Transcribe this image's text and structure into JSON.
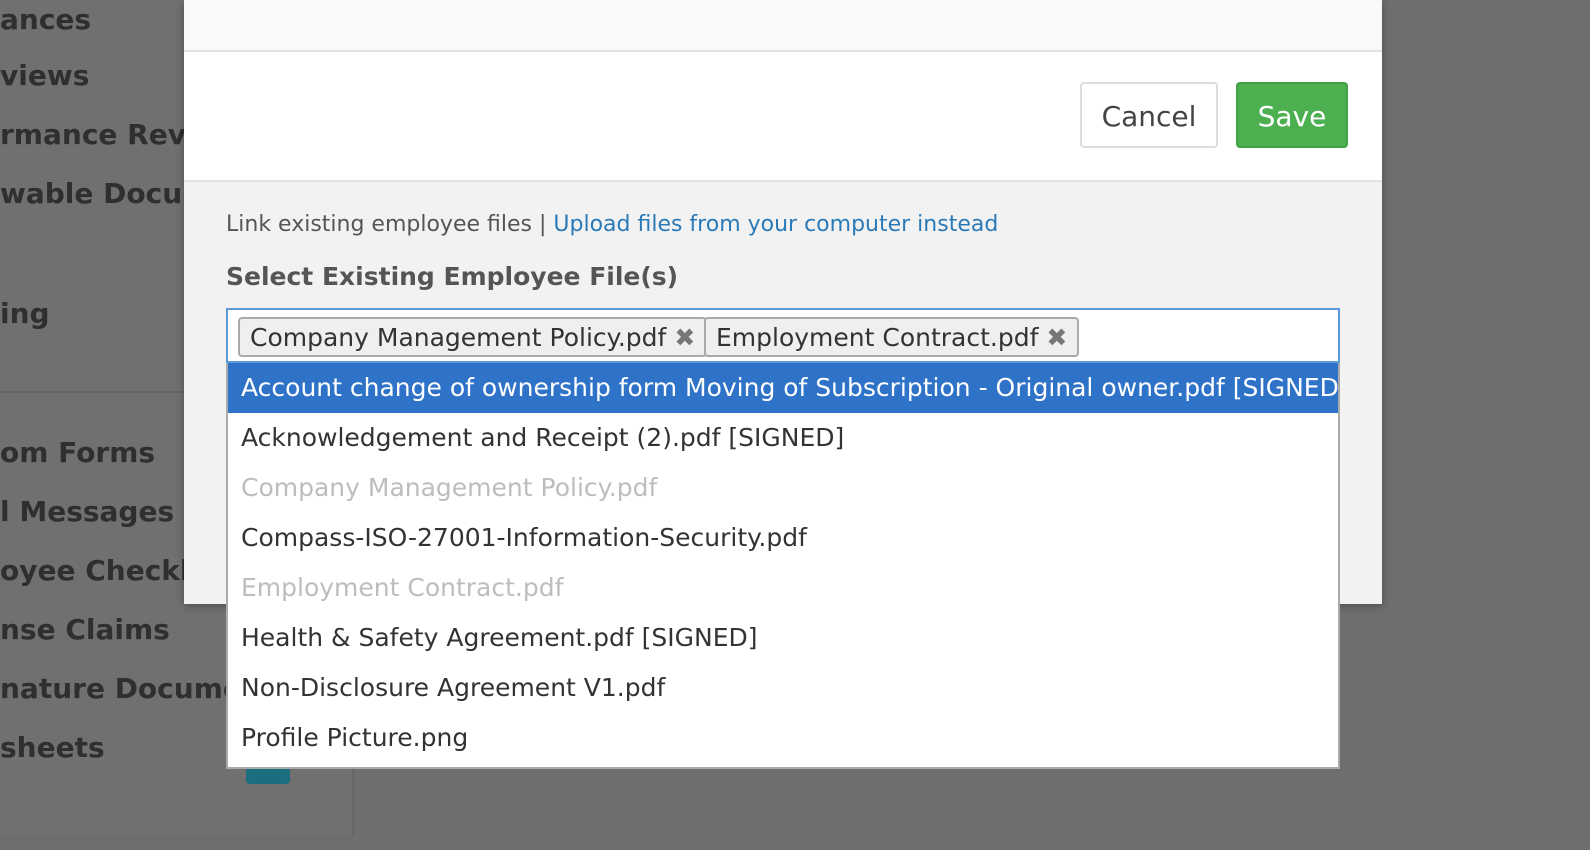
{
  "sidebar": {
    "items": [
      {
        "label": "ances"
      },
      {
        "label": "views"
      },
      {
        "label": "rmance Revie"
      },
      {
        "label": "wable Docume"
      },
      {
        "label": "ing"
      },
      {
        "label": "om Forms"
      },
      {
        "label": "l Messages"
      },
      {
        "label": "oyee Checklist"
      },
      {
        "label": "nse Claims"
      },
      {
        "label": "nature Documents"
      },
      {
        "label": "sheets"
      }
    ]
  },
  "modal": {
    "cancel_label": "Cancel",
    "save_label": "Save",
    "mode_text": "Link existing employee files |",
    "upload_link": "Upload files from your computer instead",
    "field_label": "Select Existing Employee File(s)",
    "selected_tags": [
      {
        "label": "Company Management Policy.pdf",
        "remove": "✖"
      },
      {
        "label": "Employment Contract.pdf",
        "remove": "✖"
      }
    ],
    "options": [
      {
        "label": "Account change of ownership form Moving of Subscription - Original owner.pdf [SIGNED]",
        "state": "highlighted"
      },
      {
        "label": "Acknowledgement and Receipt (2).pdf [SIGNED]",
        "state": "normal"
      },
      {
        "label": "Company Management Policy.pdf",
        "state": "disabled"
      },
      {
        "label": "Compass-ISO-27001-Information-Security.pdf",
        "state": "normal"
      },
      {
        "label": "Employment Contract.pdf",
        "state": "disabled"
      },
      {
        "label": "Health & Safety Agreement.pdf [SIGNED]",
        "state": "normal"
      },
      {
        "label": "Non-Disclosure Agreement V1.pdf",
        "state": "normal"
      },
      {
        "label": "Profile Picture.png",
        "state": "normal"
      }
    ]
  },
  "colors": {
    "save_green": "#4caf50",
    "highlight_blue": "#2f73c8",
    "link_blue": "#2a7ab8"
  }
}
